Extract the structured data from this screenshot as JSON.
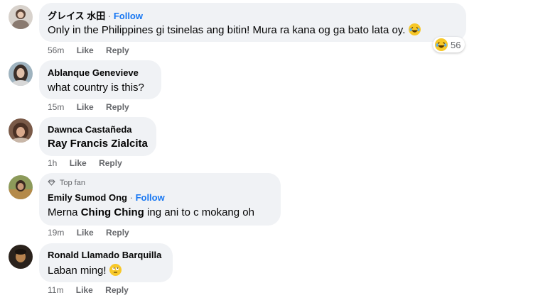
{
  "comments": [
    {
      "author": "グレイス 水田",
      "follow_sep": "·",
      "follow": "Follow",
      "text": "Only in the Philippines gi tsinelas ang bitin! Mura ra kana og ga bato lata oy.",
      "time": "56m",
      "like": "Like",
      "reply": "Reply",
      "reaction_icon": "laughing-emoji",
      "reaction_count": "56"
    },
    {
      "author": "Ablanque Genevieve",
      "text": "what country is this?",
      "time": "15m",
      "like": "Like",
      "reply": "Reply"
    },
    {
      "author": "Dawnca Castañeda",
      "text": "Ray Francis Zialcita",
      "time": "1h",
      "like": "Like",
      "reply": "Reply"
    },
    {
      "badge_icon": "diamond-icon",
      "badge": "Top fan",
      "author": "Emily Sumod Ong",
      "follow_sep": "·",
      "follow": "Follow",
      "text_prefix": "Merna",
      "text_mention": "Ching Ching",
      "text_suffix": "ing ani to c mokang oh",
      "time": "19m",
      "like": "Like",
      "reply": "Reply"
    },
    {
      "author": "Ronald Llamado Barquilla",
      "text": "Laban ming!",
      "time": "11m",
      "like": "Like",
      "reply": "Reply"
    }
  ],
  "colors": {
    "bubble": "#f0f2f5",
    "link": "#1877f2",
    "meta": "#65676b",
    "text": "#050505"
  }
}
